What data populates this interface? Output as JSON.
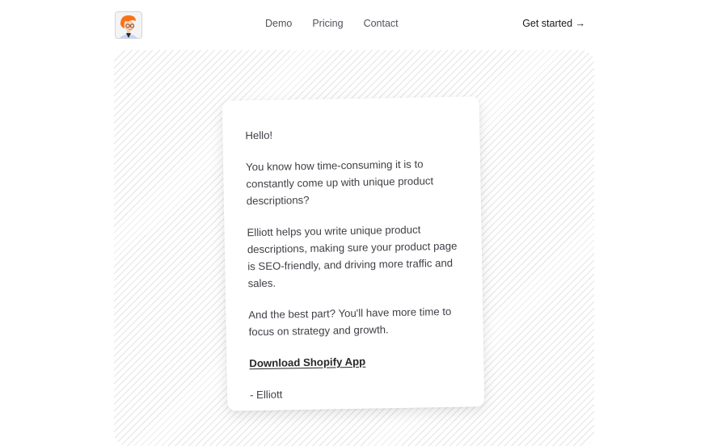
{
  "header": {
    "logo_alt": "Elliott avatar",
    "nav": [
      {
        "label": "Demo"
      },
      {
        "label": "Pricing"
      },
      {
        "label": "Contact"
      }
    ],
    "cta_label": "Get started →"
  },
  "letter": {
    "greeting": "Hello!",
    "paragraph_1": "You know how time-consuming it is to constantly come up with unique product descriptions?",
    "paragraph_2": "Elliott helps you write unique product descriptions, making sure your product page is SEO-friendly, and driving more traffic and sales.",
    "paragraph_3": "And the best part? You'll have more time to focus on strategy and growth.",
    "link_label": "Download Shopify App",
    "signature": "- Elliott"
  },
  "colors": {
    "text": "#3f3f46",
    "cta": "#18181b",
    "stripe": "#e4e4e7",
    "avatar_hair": "#f97316"
  }
}
